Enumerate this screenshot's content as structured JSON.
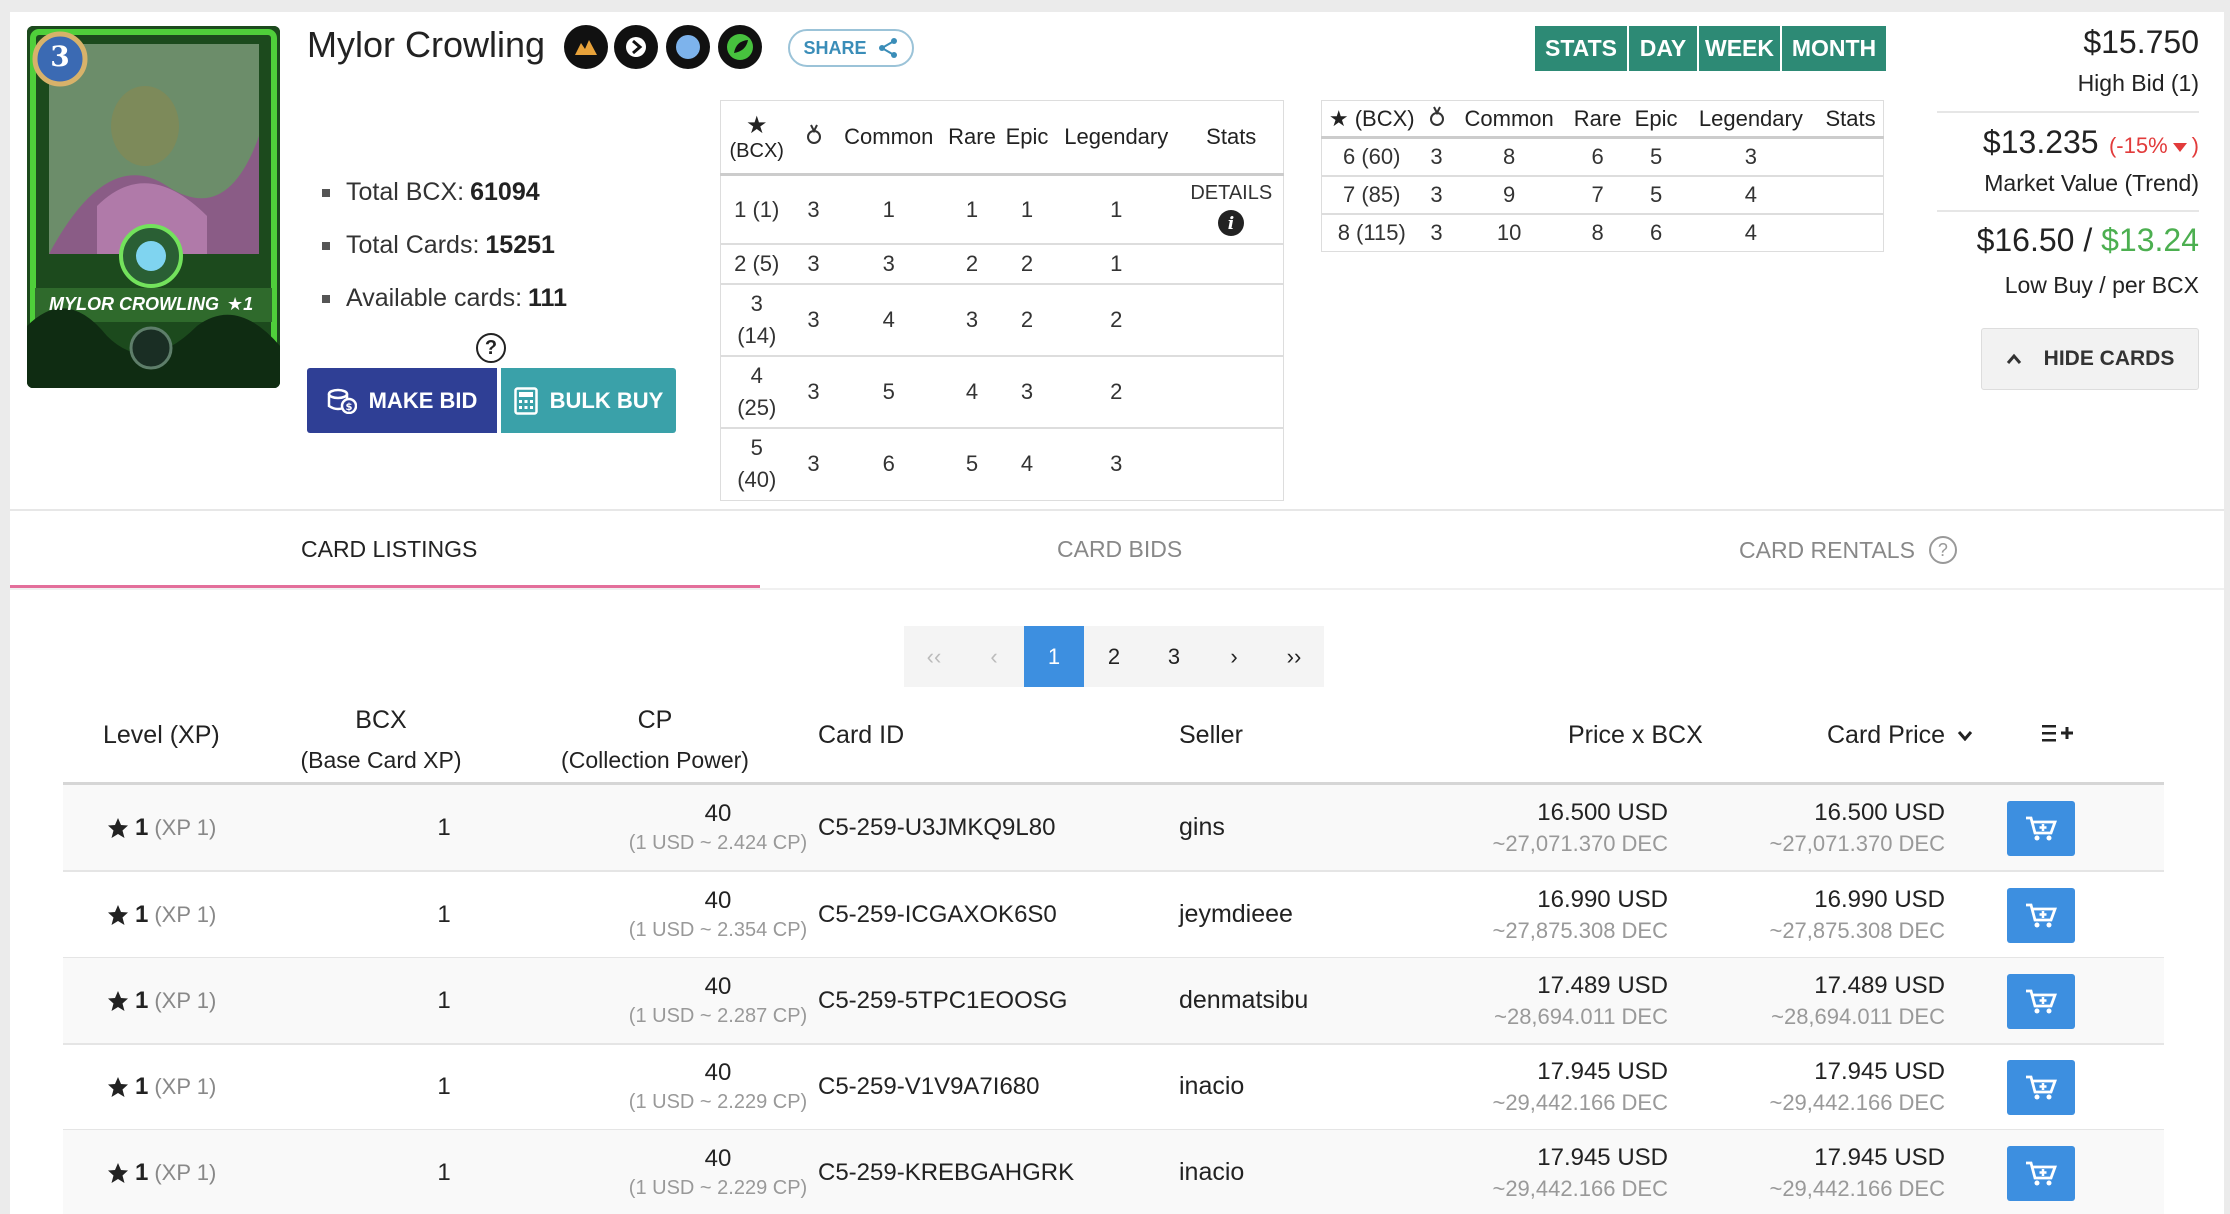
{
  "card": {
    "name": "Mylor Crowling",
    "art_label": "MYLOR CROWLING",
    "art_level": "3",
    "art_stars": "★1",
    "share_label": "SHARE"
  },
  "summary": {
    "items": [
      {
        "label": "Total BCX:",
        "value": "61094"
      },
      {
        "label": "Total Cards:",
        "value": "15251"
      },
      {
        "label": "Available cards:",
        "value": "111"
      }
    ]
  },
  "actions": {
    "help": "?",
    "make_bid": "MAKE BID",
    "bulk_buy": "BULK BUY"
  },
  "level_table_1": {
    "headers": {
      "star": "★",
      "bcx": "(BCX)",
      "common": "Common",
      "rare": "Rare",
      "epic": "Epic",
      "legendary": "Legendary",
      "stats": "Stats"
    },
    "details_label": "DETAILS",
    "rows": [
      {
        "lvl": "1 (1)",
        "g": "3",
        "c": "1",
        "r": "1",
        "e": "1",
        "l": "1"
      },
      {
        "lvl": "2 (5)",
        "g": "3",
        "c": "3",
        "r": "2",
        "e": "2",
        "l": "1"
      },
      {
        "lvl": "3 (14)",
        "g": "3",
        "c": "4",
        "r": "3",
        "e": "2",
        "l": "2"
      },
      {
        "lvl": "4 (25)",
        "g": "3",
        "c": "5",
        "r": "4",
        "e": "3",
        "l": "2"
      },
      {
        "lvl": "5 (40)",
        "g": "3",
        "c": "6",
        "r": "5",
        "e": "4",
        "l": "3"
      }
    ]
  },
  "level_table_2": {
    "headers": {
      "star": "★ (BCX)",
      "common": "Common",
      "rare": "Rare",
      "epic": "Epic",
      "legendary": "Legendary",
      "stats": "Stats"
    },
    "rows": [
      {
        "lvl": "6 (60)",
        "g": "3",
        "c": "8",
        "r": "6",
        "e": "5",
        "l": "3"
      },
      {
        "lvl": "7 (85)",
        "g": "3",
        "c": "9",
        "r": "7",
        "e": "5",
        "l": "4"
      },
      {
        "lvl": "8 (115)",
        "g": "3",
        "c": "10",
        "r": "8",
        "e": "6",
        "l": "4"
      }
    ]
  },
  "period_tabs": [
    "STATS",
    "DAY",
    "WEEK",
    "MONTH"
  ],
  "prices": {
    "high_bid_value": "$15.750",
    "high_bid_label": "High Bid (1)",
    "market_value": "$13.235",
    "trend_pct": "(-15%",
    "trend_close": ")",
    "market_label": "Market Value (Trend)",
    "low_buy": "$16.50",
    "slash": " / ",
    "per_bcx": "$13.24",
    "low_buy_label": "Low Buy / per BCX",
    "hide_cards": "HIDE CARDS",
    "colors": {
      "trend_down": "#e23b3b",
      "per_bcx": "#4caf50"
    }
  },
  "tabs": [
    {
      "label": "CARD LISTINGS",
      "active": true
    },
    {
      "label": "CARD BIDS",
      "active": false
    },
    {
      "label": "CARD RENTALS",
      "active": false
    }
  ],
  "pager": {
    "first": "‹‹",
    "prev": "‹",
    "pages": [
      "1",
      "2",
      "3"
    ],
    "current": "1",
    "next": "›",
    "last": "››"
  },
  "listings": {
    "headers": {
      "level": "Level (XP)",
      "bcx": "BCX",
      "bcx_sub": "(Base Card XP)",
      "cp": "CP",
      "cp_sub": "(Collection Power)",
      "card_id": "Card ID",
      "seller": "Seller",
      "price_bcx": "Price x BCX",
      "card_price": "Card Price"
    },
    "rows": [
      {
        "level": "1",
        "xp": "(XP 1)",
        "bcx": "1",
        "cp": "40",
        "cp_sub": "(1 USD ~ 2.424 CP)",
        "card_id": "C5-259-U3JMKQ9L80",
        "seller": "gins",
        "price_usd": "16.500 USD",
        "price_dec": "~27,071.370 DEC",
        "card_usd": "16.500 USD",
        "card_dec": "~27,071.370 DEC"
      },
      {
        "level": "1",
        "xp": "(XP 1)",
        "bcx": "1",
        "cp": "40",
        "cp_sub": "(1 USD ~ 2.354 CP)",
        "card_id": "C5-259-ICGAXOK6S0",
        "seller": "jeymdieee",
        "price_usd": "16.990 USD",
        "price_dec": "~27,875.308 DEC",
        "card_usd": "16.990 USD",
        "card_dec": "~27,875.308 DEC"
      },
      {
        "level": "1",
        "xp": "(XP 1)",
        "bcx": "1",
        "cp": "40",
        "cp_sub": "(1 USD ~ 2.287 CP)",
        "card_id": "C5-259-5TPC1EOOSG",
        "seller": "denmatsibu",
        "price_usd": "17.489 USD",
        "price_dec": "~28,694.011 DEC",
        "card_usd": "17.489 USD",
        "card_dec": "~28,694.011 DEC"
      },
      {
        "level": "1",
        "xp": "(XP 1)",
        "bcx": "1",
        "cp": "40",
        "cp_sub": "(1 USD ~ 2.229 CP)",
        "card_id": "C5-259-V1V9A7I680",
        "seller": "inacio",
        "price_usd": "17.945 USD",
        "price_dec": "~29,442.166 DEC",
        "card_usd": "17.945 USD",
        "card_dec": "~29,442.166 DEC"
      },
      {
        "level": "1",
        "xp": "(XP 1)",
        "bcx": "1",
        "cp": "40",
        "cp_sub": "(1 USD ~ 2.229 CP)",
        "card_id": "C5-259-KREBGAHGRK",
        "seller": "inacio",
        "price_usd": "17.945 USD",
        "price_dec": "~29,442.166 DEC",
        "card_usd": "17.945 USD",
        "card_dec": "~29,442.166 DEC"
      }
    ]
  }
}
